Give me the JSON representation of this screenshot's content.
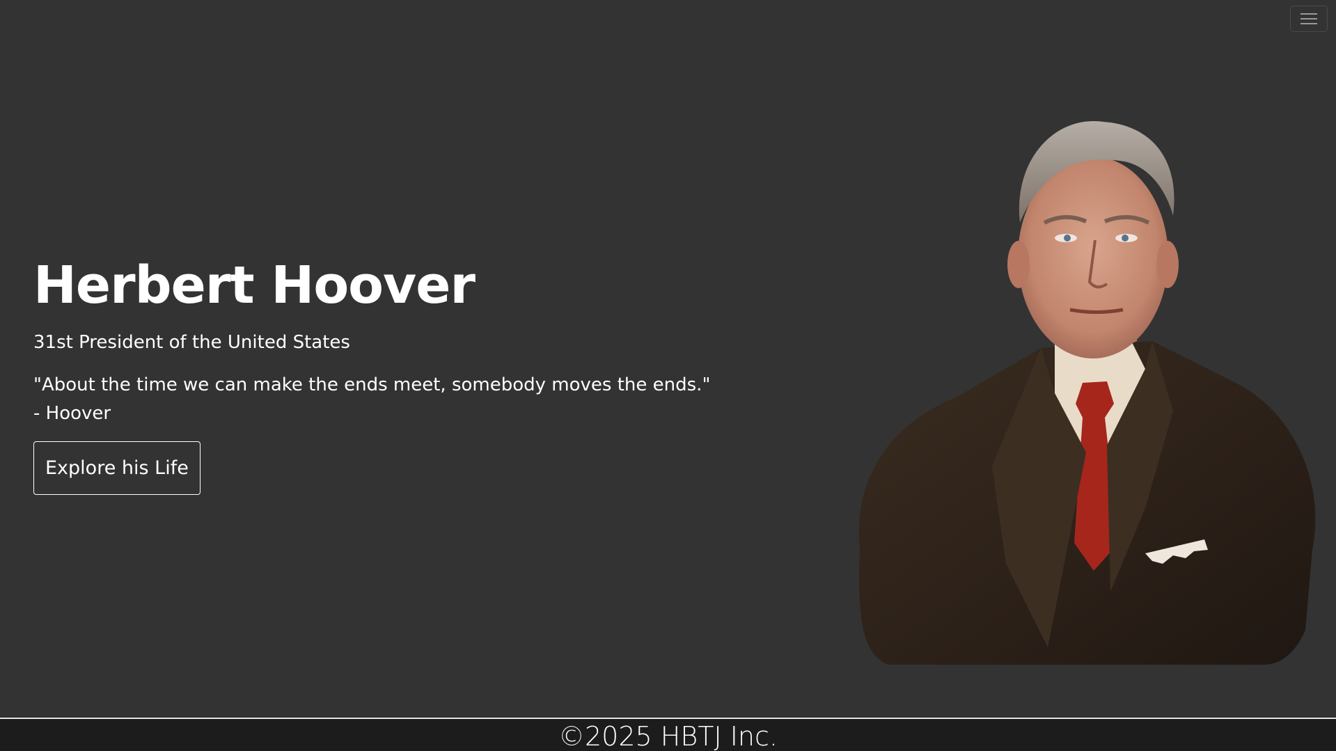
{
  "hero": {
    "title": "Herbert Hoover",
    "subtitle": "31st President of the United States",
    "quote_line1": "\"About the time we can make the ends meet, somebody moves the ends.\"",
    "quote_line2": "- Hoover",
    "button_label": "Explore his Life"
  },
  "navbar": {
    "toggle_icon": "hamburger-menu-icon"
  },
  "portrait": {
    "icon": "portrait-image"
  },
  "footer": {
    "copyright": "©2025 HBTJ Inc."
  },
  "colors": {
    "background": "#333333",
    "footer_background": "#1c1c1c",
    "text": "#ffffff",
    "suit": "#2e2218",
    "tie": "#a6261c"
  }
}
